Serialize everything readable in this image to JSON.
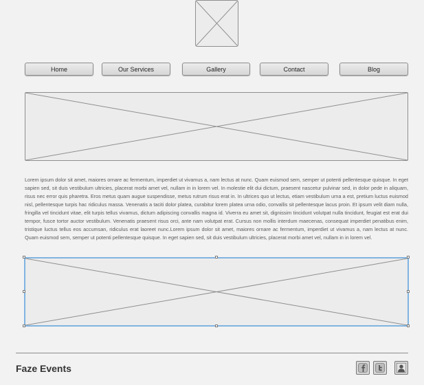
{
  "nav": {
    "items": [
      {
        "label": "Home"
      },
      {
        "label": "Our Services"
      },
      {
        "label": "Gallery"
      },
      {
        "label": "Contact"
      },
      {
        "label": "Blog"
      }
    ]
  },
  "content": {
    "body_text": "Lorem ipsum dolor sit amet, maiores ornare ac fermentum, imperdiet ut vivamus a, nam lectus at nunc. Quam euismod sem, semper ut potenti pellentesque quisque. In eget sapien sed, sit duis vestibulum ultricies, placerat morbi amet vel, nullam in in lorem vel. In molestie elit dui dictum, praesent nascetur pulvinar sed, in dolor pede in aliquam, risus nec error quis pharetra. Eros metus quam augue suspendisse, metus rutrum risus erat in.  In ultrices quo ut lectus, etiam vestibulum urna a est, pretium luctus euismod nisl, pellentesque turpis hac ridiculus massa. Venenatis a taciti dolor platea, curabitur lorem platea urna odio, convallis sit pellentesque lacus proin. Et ipsum velit diam nulla, fringilla vel tincidunt vitae, elit turpis tellus vivamus, dictum adipiscing convallis magna id. Viverra eu amet sit, dignissim tincidunt volutpat nulla tincidunt, feugiat est erat dui tempor, fusce tortor auctor vestibulum. Venenatis praesent risus orci, ante nam volutpat erat. Cursus non mollis interdum maecenas, consequat imperdiet penatibus enim, tristique luctus tellus eos accumsan, ridiculus erat laoreet nunc.Lorem ipsum dolor sit amet, maiores ornare ac fermentum, imperdiet ut vivamus a, nam lectus at nunc. Quam euismod sem, semper ut potenti pellentesque quisque. In eget sapien sed, sit duis vestibulum ultricies, placerat morbi amet vel, nullam in in lorem vel."
  },
  "footer": {
    "brand": "Faze Events",
    "social_icons": [
      "facebook-icon",
      "twitter-icon",
      "profile-icon"
    ]
  },
  "colors": {
    "background": "#f2f2f2",
    "placeholder_fill": "#ececec",
    "placeholder_border": "#8e8e8e",
    "selection": "#7fb3e0",
    "text": "#5a5a5a"
  }
}
